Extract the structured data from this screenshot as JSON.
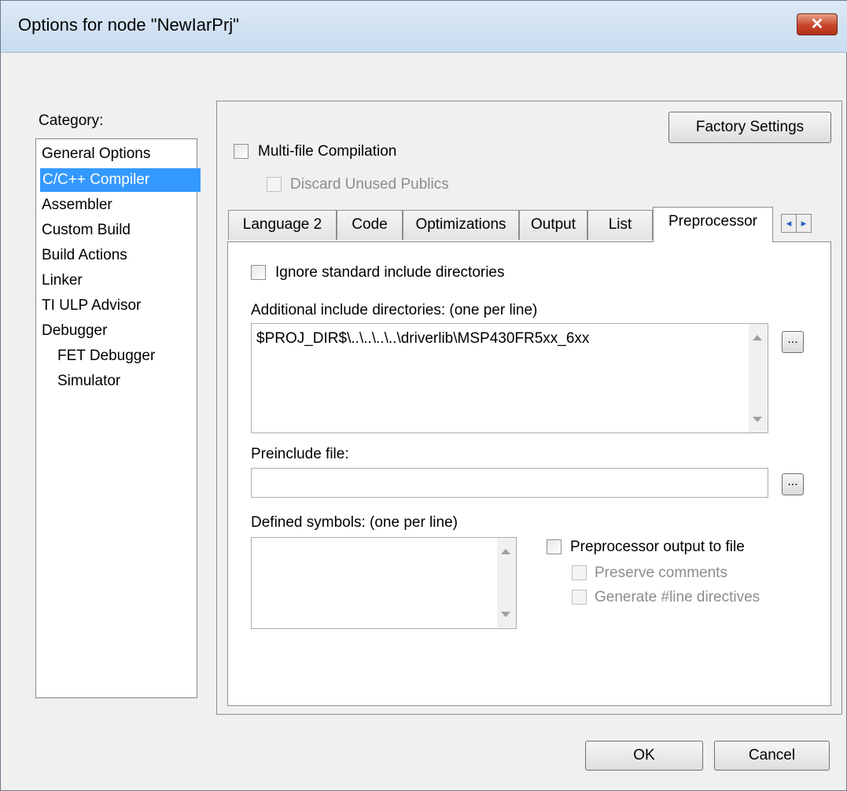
{
  "window": {
    "title": "Options for node \"NewIarPrj\"",
    "close_glyph": "✕"
  },
  "category": {
    "label": "Category:",
    "items": [
      {
        "label": "General Options",
        "selected": false
      },
      {
        "label": "C/C++ Compiler",
        "selected": true
      },
      {
        "label": "Assembler",
        "selected": false
      },
      {
        "label": "Custom Build",
        "selected": false
      },
      {
        "label": "Build Actions",
        "selected": false
      },
      {
        "label": "Linker",
        "selected": false
      },
      {
        "label": "TI ULP Advisor",
        "selected": false
      },
      {
        "label": "Debugger",
        "selected": false
      },
      {
        "label": "FET Debugger",
        "selected": false
      },
      {
        "label": "Simulator",
        "selected": false
      }
    ]
  },
  "panel": {
    "factory_settings_label": "Factory Settings",
    "multifile": {
      "label": "Multi-file Compilation",
      "checked": false
    },
    "discard": {
      "label": "Discard Unused Publics",
      "checked": false,
      "enabled": false
    }
  },
  "tabs": [
    {
      "label": "Language 2",
      "active": false
    },
    {
      "label": "Code",
      "active": false
    },
    {
      "label": "Optimizations",
      "active": false
    },
    {
      "label": "Output",
      "active": false
    },
    {
      "label": "List",
      "active": false
    },
    {
      "label": "Preprocessor",
      "active": true
    }
  ],
  "tab_scroll": {
    "left_glyph": "◂",
    "right_glyph": "▸"
  },
  "preprocessor": {
    "ignore_std": {
      "label": "Ignore standard include directories",
      "checked": false
    },
    "include_dirs": {
      "label": "Additional include directories: (one per line)",
      "value": "$PROJ_DIR$\\..\\..\\..\\..\\driverlib\\MSP430FR5xx_6xx"
    },
    "browse_glyph": "...",
    "preinclude": {
      "label": "Preinclude file:",
      "value": ""
    },
    "defined_symbols": {
      "label": "Defined symbols: (one per line)",
      "value": ""
    },
    "output_to_file": {
      "label": "Preprocessor output to file",
      "checked": false
    },
    "preserve_comments": {
      "label": "Preserve comments",
      "checked": false,
      "enabled": false
    },
    "line_directives": {
      "label": "Generate #line directives",
      "checked": false,
      "enabled": false
    }
  },
  "footer": {
    "ok_label": "OK",
    "cancel_label": "Cancel"
  }
}
